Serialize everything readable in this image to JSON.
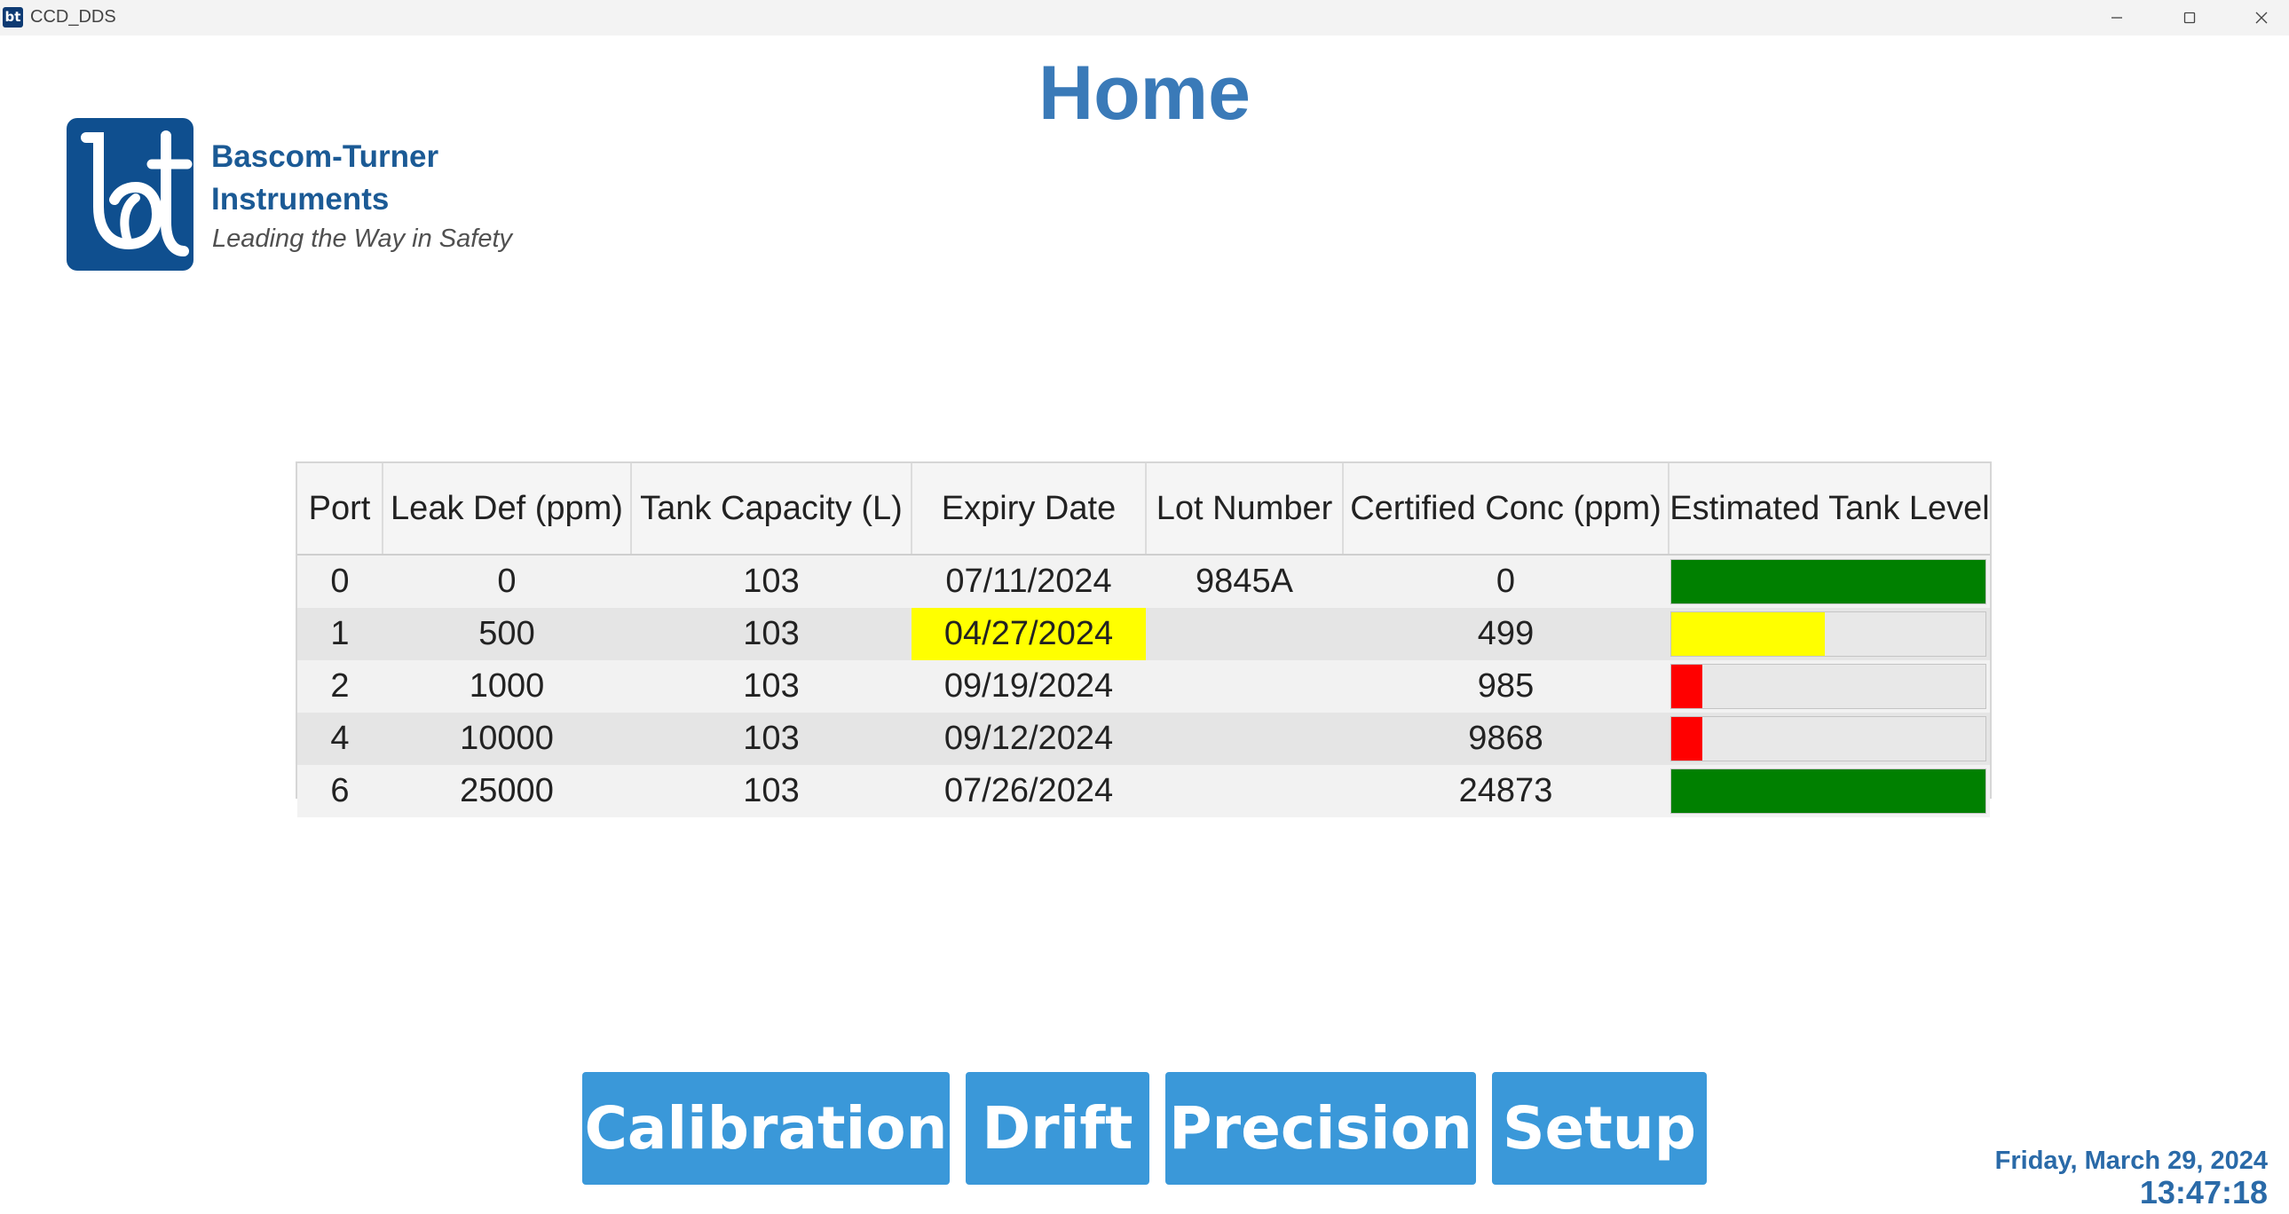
{
  "window": {
    "title": "CCD_DDS",
    "icon_glyph": "bt"
  },
  "page": {
    "title": "Home"
  },
  "logo": {
    "company": "Bascom-Turner\nInstruments",
    "tagline": "Leading the Way in Safety",
    "brand_color": "#1b5a95"
  },
  "table": {
    "headers": [
      "Port",
      "Leak Def (ppm)",
      "Tank Capacity (L)",
      "Expiry Date",
      "Lot Number",
      "Certified Conc (ppm)",
      "Estimated Tank Level"
    ],
    "rows": [
      {
        "port": "0",
        "leak_def": "0",
        "capacity": "103",
        "expiry": "07/11/2024",
        "expiry_highlight": false,
        "lot": "9845A",
        "conc": "0",
        "level": 1.0,
        "level_color": "#008000"
      },
      {
        "port": "1",
        "leak_def": "500",
        "capacity": "103",
        "expiry": "04/27/2024",
        "expiry_highlight": true,
        "lot": "",
        "conc": "499",
        "level": 0.49,
        "level_color": "#ffff00"
      },
      {
        "port": "2",
        "leak_def": "1000",
        "capacity": "103",
        "expiry": "09/19/2024",
        "expiry_highlight": false,
        "lot": "",
        "conc": "985",
        "level": 0.1,
        "level_color": "#ff0000"
      },
      {
        "port": "4",
        "leak_def": "10000",
        "capacity": "103",
        "expiry": "09/12/2024",
        "expiry_highlight": false,
        "lot": "",
        "conc": "9868",
        "level": 0.1,
        "level_color": "#ff0000"
      },
      {
        "port": "6",
        "leak_def": "25000",
        "capacity": "103",
        "expiry": "07/26/2024",
        "expiry_highlight": false,
        "lot": "",
        "conc": "24873",
        "level": 1.0,
        "level_color": "#008000"
      }
    ],
    "expiry_highlight_color": "#ffff00"
  },
  "buttons": {
    "calibration": "Calibration",
    "drift": "Drift",
    "precision": "Precision",
    "setup": "Setup"
  },
  "status": {
    "date": "Friday, March 29, 2024",
    "time": "13:47:18"
  },
  "colors": {
    "accent": "#3a98d9",
    "title": "#3a7ab8"
  }
}
